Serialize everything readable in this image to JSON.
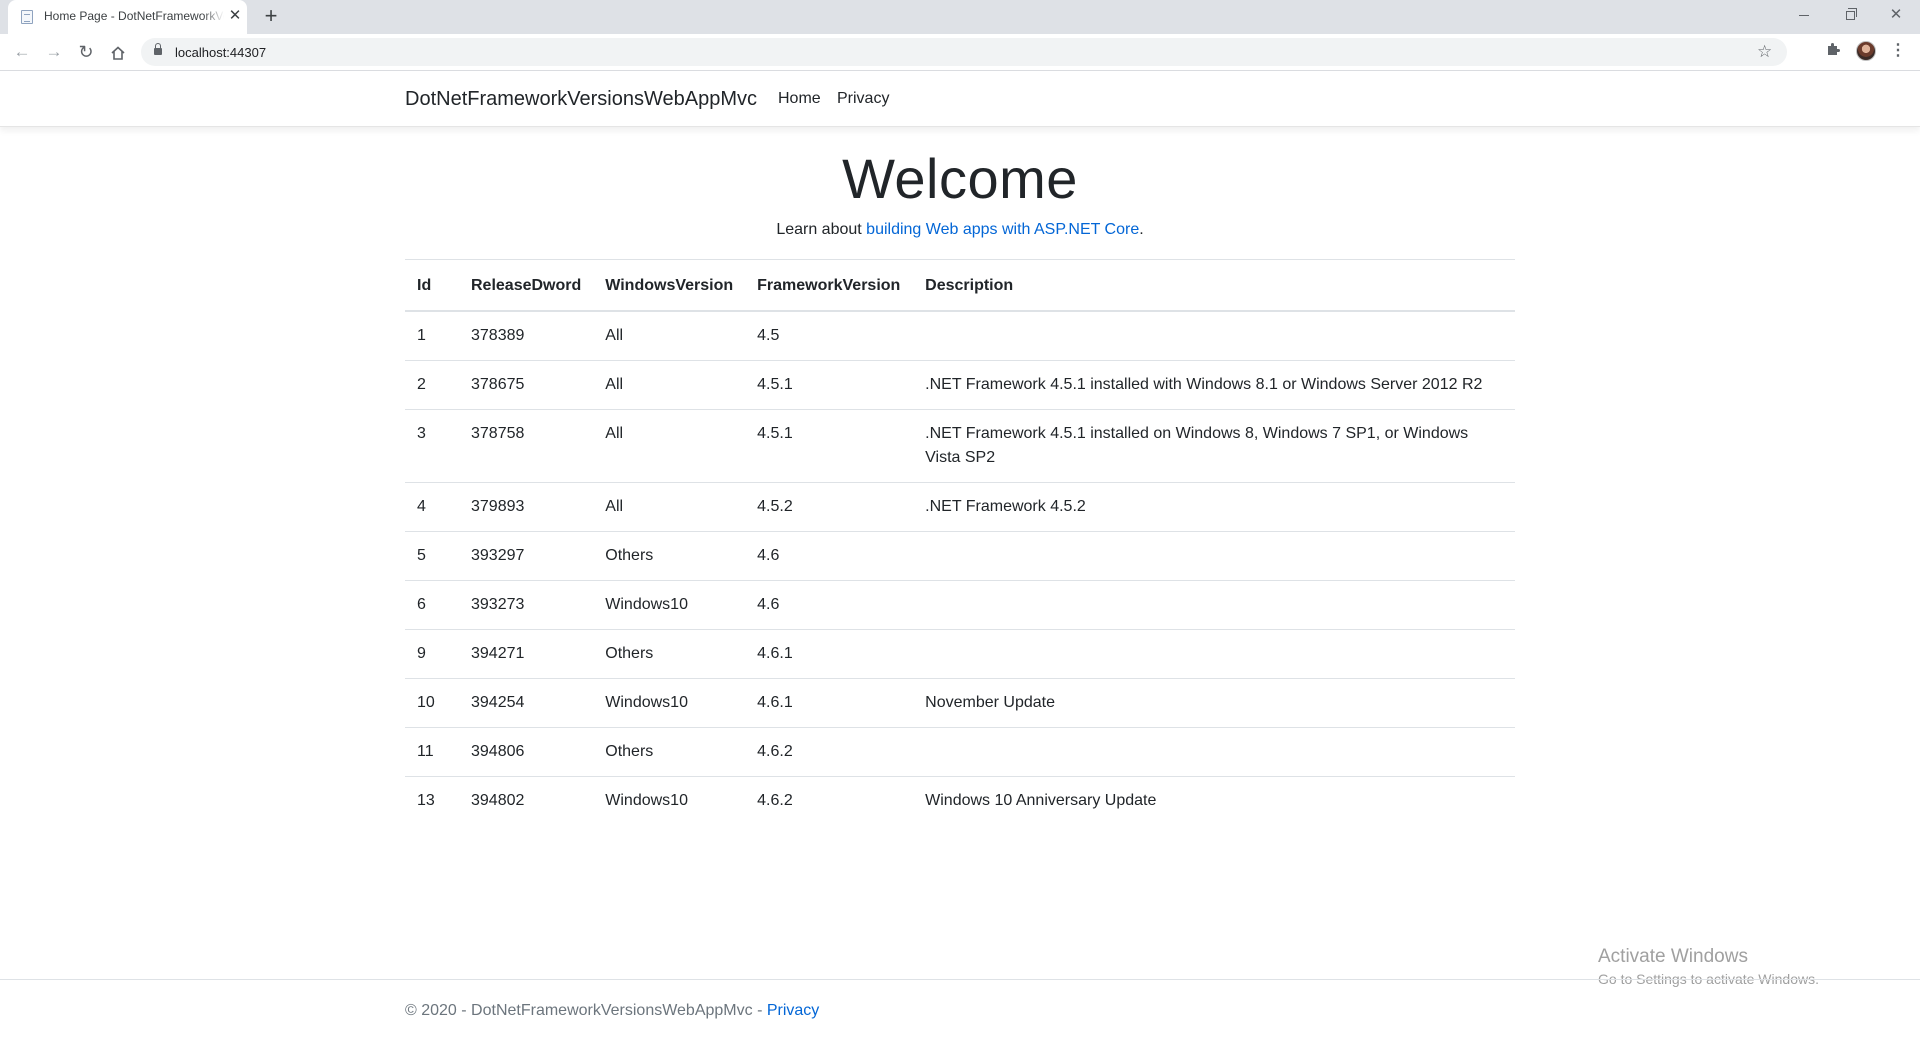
{
  "browser": {
    "tab_title": "Home Page - DotNetFrameworkVersionsWebAppMvc",
    "url": "localhost:44307"
  },
  "navbar": {
    "brand": "DotNetFrameworkVersionsWebAppMvc",
    "links": [
      "Home",
      "Privacy"
    ]
  },
  "main": {
    "heading": "Welcome",
    "intro_prefix": "Learn about ",
    "intro_link": "building Web apps with ASP.NET Core",
    "intro_suffix": "."
  },
  "table": {
    "columns": [
      "Id",
      "ReleaseDword",
      "WindowsVersion",
      "FrameworkVersion",
      "Description"
    ],
    "rows": [
      [
        "1",
        "378389",
        "All",
        "4.5",
        ""
      ],
      [
        "2",
        "378675",
        "All",
        "4.5.1",
        ".NET Framework 4.5.1 installed with Windows 8.1 or Windows Server 2012 R2"
      ],
      [
        "3",
        "378758",
        "All",
        "4.5.1",
        ".NET Framework 4.5.1 installed on Windows 8, Windows 7 SP1, or Windows Vista SP2"
      ],
      [
        "4",
        "379893",
        "All",
        "4.5.2",
        ".NET Framework 4.5.2"
      ],
      [
        "5",
        "393297",
        "Others",
        "4.6",
        ""
      ],
      [
        "6",
        "393273",
        "Windows10",
        "4.6",
        ""
      ],
      [
        "9",
        "394271",
        "Others",
        "4.6.1",
        ""
      ],
      [
        "10",
        "394254",
        "Windows10",
        "4.6.1",
        "November Update"
      ],
      [
        "11",
        "394806",
        "Others",
        "4.6.2",
        ""
      ],
      [
        "13",
        "394802",
        "Windows10",
        "4.6.2",
        "Windows 10 Anniversary Update"
      ]
    ]
  },
  "watermark": {
    "title": "Activate Windows",
    "subtitle": "Go to Settings to activate Windows."
  },
  "footer": {
    "prefix": "© 2020 - DotNetFrameworkVersionsWebAppMvc - ",
    "link": "Privacy"
  },
  "colors": {
    "link": "#0366d6",
    "text": "#212529",
    "muted": "#6c757d",
    "border": "#dee2e6"
  },
  "icons": [
    "page-favicon-icon",
    "close-icon",
    "plus-icon",
    "back-arrow-icon",
    "forward-arrow-icon",
    "reload-icon",
    "home-icon",
    "lock-icon",
    "star-icon",
    "puzzle-icon",
    "kebab-menu-icon"
  ]
}
